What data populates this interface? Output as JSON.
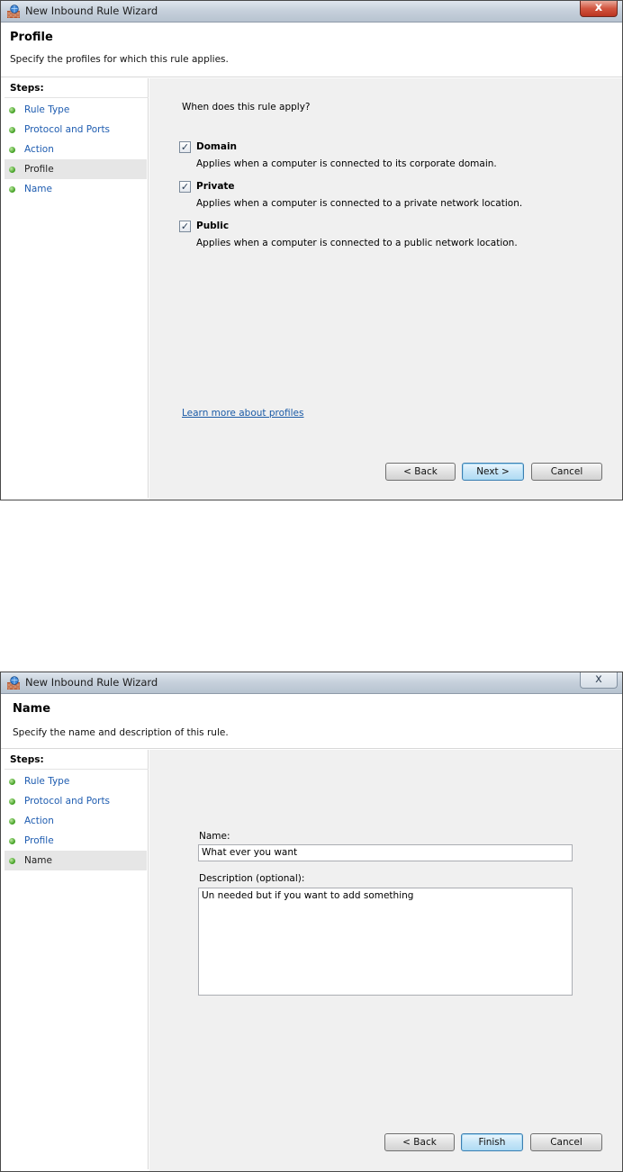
{
  "colors": {
    "link": "#1a5aa6",
    "step_done": "#3b9c1d",
    "content_bg": "#f0f0f0"
  },
  "window1": {
    "title": "New Inbound Rule Wizard",
    "close_glyph": "x",
    "header_title": "Profile",
    "header_subtitle": "Specify the profiles for which this rule applies.",
    "steps_title": "Steps:",
    "steps": [
      "Rule Type",
      "Protocol and Ports",
      "Action",
      "Profile",
      "Name"
    ],
    "current_step": "Profile",
    "question": "When does this rule apply?",
    "options": [
      {
        "label": "Domain",
        "desc": "Applies when a computer is connected to its corporate domain.",
        "checked": true
      },
      {
        "label": "Private",
        "desc": "Applies when a computer is connected to a private network location.",
        "checked": true
      },
      {
        "label": "Public",
        "desc": "Applies when a computer is connected to a public network location.",
        "checked": true
      }
    ],
    "check_glyph": "✓",
    "learn_more": "Learn more about profiles",
    "buttons": {
      "back": "< Back",
      "next": "Next >",
      "cancel": "Cancel"
    }
  },
  "window2": {
    "title": "New Inbound Rule Wizard",
    "close_glyph": "x",
    "header_title": "Name",
    "header_subtitle": "Specify the name and description of this rule.",
    "steps_title": "Steps:",
    "steps": [
      "Rule Type",
      "Protocol and Ports",
      "Action",
      "Profile",
      "Name"
    ],
    "current_step": "Name",
    "name_label": "Name:",
    "name_value": "What ever you want",
    "description_label": "Description (optional):",
    "description_value": "Un needed but if you want to add something",
    "buttons": {
      "back": "< Back",
      "finish": "Finish",
      "cancel": "Cancel"
    }
  }
}
